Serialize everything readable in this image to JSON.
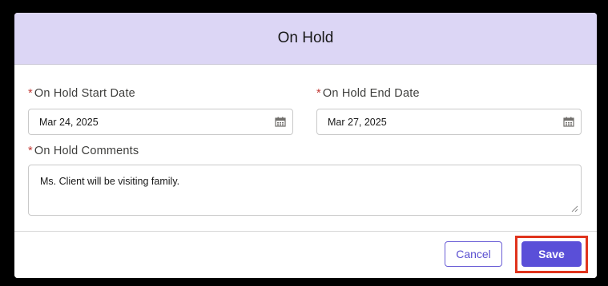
{
  "modal": {
    "title": "On Hold"
  },
  "fields": {
    "start_date": {
      "label": "On Hold Start Date",
      "value": "Mar 24, 2025",
      "required_marker": "*"
    },
    "end_date": {
      "label": "On Hold End Date",
      "value": "Mar 27, 2025",
      "required_marker": "*"
    },
    "comments": {
      "label": "On Hold Comments",
      "value": "Ms. Client will be visiting family.",
      "required_marker": "*"
    }
  },
  "footer": {
    "cancel_label": "Cancel",
    "save_label": "Save"
  },
  "colors": {
    "header_bg": "#dcd6f5",
    "brand": "#5a4fd8",
    "required": "#c23934",
    "highlight": "#e0341d"
  },
  "icons": [
    "calendar-icon",
    "resize-handle-icon"
  ]
}
